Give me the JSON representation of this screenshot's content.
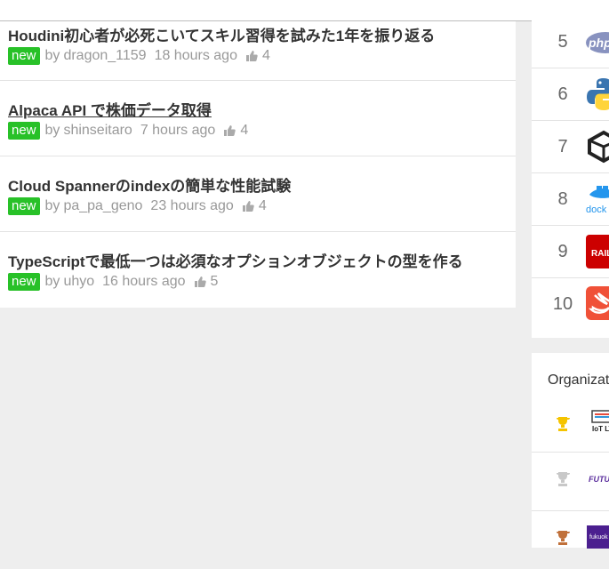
{
  "feed": {
    "items": [
      {
        "title": "Houdini初心者が必死こいてスキル習得を試みた1年を振り返る",
        "badge": "new",
        "by": "by",
        "user": "dragon_1159",
        "time": "18 hours ago",
        "likes": "4"
      },
      {
        "title": "Alpaca API で株価データ取得",
        "badge": "new",
        "by": "by",
        "user": "shinseitaro",
        "time": "7 hours ago",
        "likes": "4"
      },
      {
        "title": "Cloud Spannerのindexの簡単な性能試験",
        "badge": "new",
        "by": "by",
        "user": "pa_pa_geno",
        "time": "23 hours ago",
        "likes": "4"
      },
      {
        "title": "TypeScriptで最低一つは必須なオプションオブジェクトの型を作る",
        "badge": "new",
        "by": "by",
        "user": "uhyo",
        "time": "16 hours ago",
        "likes": "5"
      }
    ]
  },
  "ranking": {
    "rows": [
      {
        "rank": "5",
        "icon": "php-icon",
        "icon_text": "php"
      },
      {
        "rank": "6",
        "icon": "python-icon"
      },
      {
        "rank": "7",
        "icon": "unity-icon"
      },
      {
        "rank": "8",
        "icon": "docker-icon",
        "icon_text": "dock"
      },
      {
        "rank": "9",
        "icon": "rails-icon",
        "icon_text": "RAIL"
      },
      {
        "rank": "10",
        "icon": "swift-icon"
      }
    ]
  },
  "organizations": {
    "title": "Organizat",
    "rows": [
      {
        "trophy": "gold-trophy-icon",
        "logo": "iot-lt-logo",
        "logo_text": "IoT LT"
      },
      {
        "trophy": "silver-trophy-icon",
        "logo": "future-logo",
        "logo_text": "FUTU"
      },
      {
        "trophy": "bronze-trophy-icon",
        "logo": "fukuoka-logo",
        "logo_text": "fukuok"
      }
    ]
  },
  "colors": {
    "badge": "#28c128",
    "gold": "#f5c400",
    "silver": "#c8c8c8",
    "bronze": "#c0703a"
  }
}
